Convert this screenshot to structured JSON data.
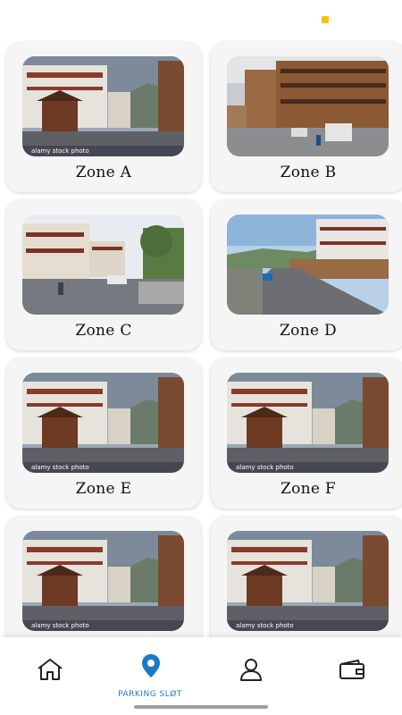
{
  "colors": {
    "accent": "#1e78c8",
    "indicator": "#f4c20d",
    "card_bg": "#f5f5f5"
  },
  "zones": [
    {
      "label": "Zone A",
      "scene": "clocktower",
      "watermark": "alamy stock photo"
    },
    {
      "label": "Zone B",
      "scene": "street-b",
      "watermark": ""
    },
    {
      "label": "Zone C",
      "scene": "street-c",
      "watermark": ""
    },
    {
      "label": "Zone D",
      "scene": "street-d",
      "watermark": ""
    },
    {
      "label": "Zone E",
      "scene": "clocktower",
      "watermark": "alamy stock photo"
    },
    {
      "label": "Zone F",
      "scene": "clocktower",
      "watermark": "alamy stock photo"
    },
    {
      "label": "",
      "scene": "clocktower",
      "watermark": "alamy stock photo"
    },
    {
      "label": "",
      "scene": "clocktower",
      "watermark": "alamy stock photo"
    }
  ],
  "nav": {
    "items": [
      {
        "icon": "home-icon",
        "label": ""
      },
      {
        "icon": "location-pin-icon",
        "label": "PARKING SLØT",
        "active": true
      },
      {
        "icon": "profile-icon",
        "label": ""
      },
      {
        "icon": "wallet-icon",
        "label": ""
      }
    ]
  }
}
